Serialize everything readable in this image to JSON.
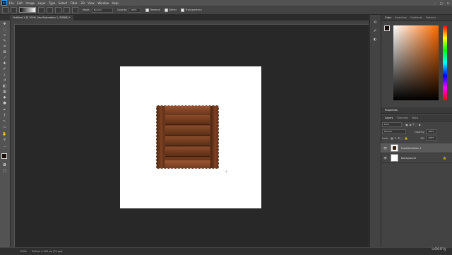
{
  "menubar": {
    "app_icon": "Ps",
    "items": [
      "File",
      "Edit",
      "Image",
      "Layer",
      "Type",
      "Select",
      "Filter",
      "3D",
      "View",
      "Window",
      "Help"
    ],
    "window_controls": [
      "–",
      "□",
      "✕"
    ]
  },
  "options": {
    "mode_label": "Mode:",
    "mode_value": "Normal",
    "opacity_label": "Opacity:",
    "opacity_value": "100%",
    "reverse_label": "Reverse",
    "dither_label": "Dither",
    "transparency_label": "Transparency"
  },
  "document": {
    "tab_title": "Untitled-1 @ 100% (HueSaturation 1, RGB/8) *"
  },
  "status": {
    "zoom": "100%",
    "doc_info": "500 px x 500 px (72 ppi)"
  },
  "color_panel": {
    "tabs": [
      "Color",
      "Swatches",
      "Gradients",
      "Patterns"
    ],
    "fg_color": "#1a0f08",
    "bg_color": "#7a4a2a",
    "selected_hue": "#ff6a00"
  },
  "layers_panel": {
    "properties_label": "Properties",
    "tabs": [
      "Layers",
      "Channels",
      "Paths"
    ],
    "kind_label": "Kind",
    "blend_mode": "Normal",
    "opacity_label": "Opacity:",
    "opacity_value": "100%",
    "lock_label": "Lock:",
    "fill_label": "Fill:",
    "fill_value": "100%",
    "layers": [
      {
        "name": "HueSaturation 1",
        "selected": true
      },
      {
        "name": "Background",
        "selected": false
      }
    ]
  },
  "watermark": "udemy",
  "accent_colors": {
    "crate_dark": "#5b2e16",
    "crate_light": "#9a5632",
    "canvas": "#ffffff",
    "workspace": "#282828"
  }
}
